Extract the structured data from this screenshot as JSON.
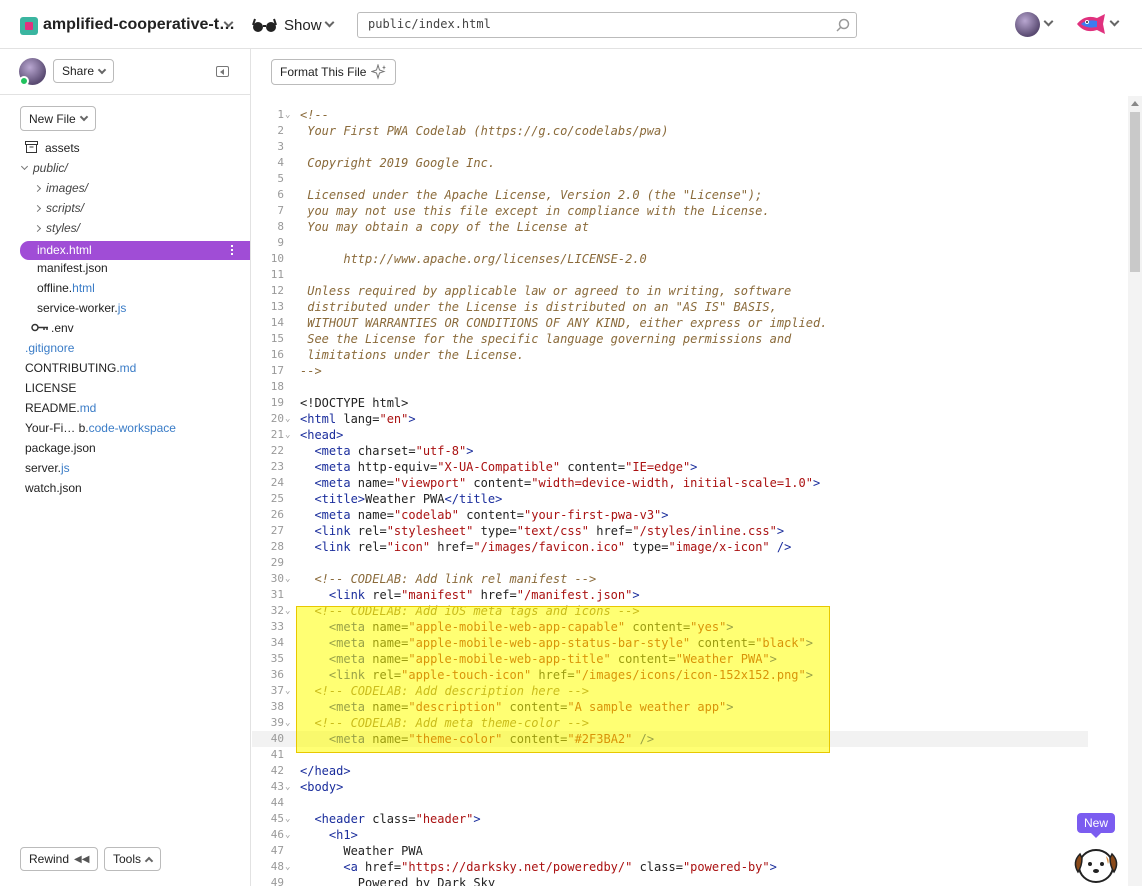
{
  "topbar": {
    "project_name": "amplified-cooperative-t…",
    "show_label": "Show",
    "file_path": "public/index.html"
  },
  "sidebar": {
    "share_label": "Share",
    "new_file_label": "New File",
    "rewind_label": "Rewind",
    "tools_label": "Tools",
    "files": [
      {
        "name": "assets",
        "ext": "",
        "kind": "assets"
      },
      {
        "name": "public/",
        "ext": "",
        "kind": "folder-open"
      },
      {
        "name": "images/",
        "ext": "",
        "kind": "folder"
      },
      {
        "name": "scripts/",
        "ext": "",
        "kind": "folder"
      },
      {
        "name": "styles/",
        "ext": "",
        "kind": "folder"
      },
      {
        "name": "index.html",
        "ext": "",
        "kind": "selected"
      },
      {
        "name": "manifest.json",
        "ext": "",
        "kind": "file"
      },
      {
        "name": "offline.",
        "ext": "html",
        "kind": "file"
      },
      {
        "name": "service-worker.",
        "ext": "js",
        "kind": "file"
      },
      {
        "name": ".env",
        "ext": "",
        "kind": "env"
      },
      {
        "name": "",
        "ext": ".gitignore",
        "kind": "file"
      },
      {
        "name": "CONTRIBUTING.",
        "ext": "md",
        "kind": "file"
      },
      {
        "name": "LICENSE",
        "ext": "",
        "kind": "file"
      },
      {
        "name": "README.",
        "ext": "md",
        "kind": "file"
      },
      {
        "name": "Your-Fi… b.",
        "ext": "code-workspace",
        "kind": "file"
      },
      {
        "name": "package.json",
        "ext": "",
        "kind": "file"
      },
      {
        "name": "server.",
        "ext": "js",
        "kind": "file"
      },
      {
        "name": "watch.json",
        "ext": "",
        "kind": "file"
      }
    ]
  },
  "editor": {
    "format_label": "Format This File",
    "new_badge": "New",
    "lines": [
      {
        "n": "1",
        "f": true,
        "t": [
          [
            "cm",
            "<!--"
          ]
        ]
      },
      {
        "n": "2",
        "t": [
          [
            "cm",
            " Your First PWA Codelab (https://g.co/codelabs/pwa)"
          ]
        ]
      },
      {
        "n": "3",
        "t": []
      },
      {
        "n": "4",
        "t": [
          [
            "cm",
            " Copyright 2019 Google Inc."
          ]
        ]
      },
      {
        "n": "5",
        "t": []
      },
      {
        "n": "6",
        "t": [
          [
            "cm",
            " Licensed under the Apache License, Version 2.0 (the \"License\");"
          ]
        ]
      },
      {
        "n": "7",
        "t": [
          [
            "cm",
            " you may not use this file except in compliance with the License."
          ]
        ]
      },
      {
        "n": "8",
        "t": [
          [
            "cm",
            " You may obtain a copy of the License at"
          ]
        ]
      },
      {
        "n": "9",
        "t": []
      },
      {
        "n": "10",
        "t": [
          [
            "cm",
            "      http://www.apache.org/licenses/LICENSE-2.0"
          ]
        ]
      },
      {
        "n": "11",
        "t": []
      },
      {
        "n": "12",
        "t": [
          [
            "cm",
            " Unless required by applicable law or agreed to in writing, software"
          ]
        ]
      },
      {
        "n": "13",
        "t": [
          [
            "cm",
            " distributed under the License is distributed on an \"AS IS\" BASIS,"
          ]
        ]
      },
      {
        "n": "14",
        "t": [
          [
            "cm",
            " WITHOUT WARRANTIES OR CONDITIONS OF ANY KIND, either express or implied."
          ]
        ]
      },
      {
        "n": "15",
        "t": [
          [
            "cm",
            " See the License for the specific language governing permissions and"
          ]
        ]
      },
      {
        "n": "16",
        "t": [
          [
            "cm",
            " limitations under the License."
          ]
        ]
      },
      {
        "n": "17",
        "t": [
          [
            "cm",
            "-->"
          ]
        ]
      },
      {
        "n": "18",
        "t": []
      },
      {
        "n": "19",
        "t": [
          [
            "at",
            "<!DOCTYPE html>"
          ]
        ]
      },
      {
        "n": "20",
        "f": true,
        "t": [
          [
            "tg",
            "<html"
          ],
          [
            "at",
            " lang="
          ],
          [
            "st",
            "\"en\""
          ],
          [
            "tg",
            ">"
          ]
        ]
      },
      {
        "n": "21",
        "f": true,
        "t": [
          [
            "tg",
            "<head>"
          ]
        ]
      },
      {
        "n": "22",
        "t": [
          [
            "at",
            "  "
          ],
          [
            "tg",
            "<meta"
          ],
          [
            "at",
            " charset="
          ],
          [
            "st",
            "\"utf-8\""
          ],
          [
            "tg",
            ">"
          ]
        ]
      },
      {
        "n": "23",
        "t": [
          [
            "at",
            "  "
          ],
          [
            "tg",
            "<meta"
          ],
          [
            "at",
            " http-equiv="
          ],
          [
            "st",
            "\"X-UA-Compatible\""
          ],
          [
            "at",
            " content="
          ],
          [
            "st",
            "\"IE=edge\""
          ],
          [
            "tg",
            ">"
          ]
        ]
      },
      {
        "n": "24",
        "t": [
          [
            "at",
            "  "
          ],
          [
            "tg",
            "<meta"
          ],
          [
            "at",
            " name="
          ],
          [
            "st",
            "\"viewport\""
          ],
          [
            "at",
            " content="
          ],
          [
            "st",
            "\"width=device-width, initial-scale=1.0\""
          ],
          [
            "tg",
            ">"
          ]
        ]
      },
      {
        "n": "25",
        "t": [
          [
            "at",
            "  "
          ],
          [
            "tg",
            "<title>"
          ],
          [
            "at",
            "Weather PWA"
          ],
          [
            "tg",
            "</title>"
          ]
        ]
      },
      {
        "n": "26",
        "t": [
          [
            "at",
            "  "
          ],
          [
            "tg",
            "<meta"
          ],
          [
            "at",
            " name="
          ],
          [
            "st",
            "\"codelab\""
          ],
          [
            "at",
            " content="
          ],
          [
            "st",
            "\"your-first-pwa-v3\""
          ],
          [
            "tg",
            ">"
          ]
        ]
      },
      {
        "n": "27",
        "t": [
          [
            "at",
            "  "
          ],
          [
            "tg",
            "<link"
          ],
          [
            "at",
            " rel="
          ],
          [
            "st",
            "\"stylesheet\""
          ],
          [
            "at",
            " type="
          ],
          [
            "st",
            "\"text/css\""
          ],
          [
            "at",
            " href="
          ],
          [
            "st",
            "\"/styles/inline.css\""
          ],
          [
            "tg",
            ">"
          ]
        ]
      },
      {
        "n": "28",
        "t": [
          [
            "at",
            "  "
          ],
          [
            "tg",
            "<link"
          ],
          [
            "at",
            " rel="
          ],
          [
            "st",
            "\"icon\""
          ],
          [
            "at",
            " href="
          ],
          [
            "st",
            "\"/images/favicon.ico\""
          ],
          [
            "at",
            " type="
          ],
          [
            "st",
            "\"image/x-icon\""
          ],
          [
            "tg",
            " />"
          ]
        ]
      },
      {
        "n": "29",
        "t": []
      },
      {
        "n": "30",
        "f": true,
        "t": [
          [
            "at",
            "  "
          ],
          [
            "cm",
            "<!-- CODELAB: Add link rel manifest -->"
          ]
        ]
      },
      {
        "n": "31",
        "t": [
          [
            "at",
            "    "
          ],
          [
            "tg",
            "<link"
          ],
          [
            "at",
            " rel="
          ],
          [
            "st",
            "\"manifest\""
          ],
          [
            "at",
            " href="
          ],
          [
            "st",
            "\"/manifest.json\""
          ],
          [
            "tg",
            ">"
          ]
        ]
      },
      {
        "n": "32",
        "f": true,
        "t": [
          [
            "at",
            "  "
          ],
          [
            "cm",
            "<!-- CODELAB: Add iOS meta tags and icons -->"
          ]
        ]
      },
      {
        "n": "33",
        "t": [
          [
            "at",
            "    "
          ],
          [
            "tg",
            "<meta"
          ],
          [
            "at",
            " name="
          ],
          [
            "st",
            "\"apple-mobile-web-app-capable\""
          ],
          [
            "at",
            " content="
          ],
          [
            "st",
            "\"yes\""
          ],
          [
            "tg",
            ">"
          ]
        ]
      },
      {
        "n": "34",
        "t": [
          [
            "at",
            "    "
          ],
          [
            "tg",
            "<meta"
          ],
          [
            "at",
            " name="
          ],
          [
            "st",
            "\"apple-mobile-web-app-status-bar-style\""
          ],
          [
            "at",
            " content="
          ],
          [
            "st",
            "\"black\""
          ],
          [
            "tg",
            ">"
          ]
        ]
      },
      {
        "n": "35",
        "t": [
          [
            "at",
            "    "
          ],
          [
            "tg",
            "<meta"
          ],
          [
            "at",
            " name="
          ],
          [
            "st",
            "\"apple-mobile-web-app-title\""
          ],
          [
            "at",
            " content="
          ],
          [
            "st",
            "\"Weather PWA\""
          ],
          [
            "tg",
            ">"
          ]
        ]
      },
      {
        "n": "36",
        "t": [
          [
            "at",
            "    "
          ],
          [
            "tg",
            "<link"
          ],
          [
            "at",
            " rel="
          ],
          [
            "st",
            "\"apple-touch-icon\""
          ],
          [
            "at",
            " href="
          ],
          [
            "st",
            "\"/images/icons/icon-152x152.png\""
          ],
          [
            "tg",
            ">"
          ]
        ]
      },
      {
        "n": "37",
        "f": true,
        "t": [
          [
            "at",
            "  "
          ],
          [
            "cm",
            "<!-- CODELAB: Add description here -->"
          ]
        ]
      },
      {
        "n": "38",
        "t": [
          [
            "at",
            "    "
          ],
          [
            "tg",
            "<meta"
          ],
          [
            "at",
            " name="
          ],
          [
            "st",
            "\"description\""
          ],
          [
            "at",
            " content="
          ],
          [
            "st",
            "\"A sample weather app\""
          ],
          [
            "tg",
            ">"
          ]
        ]
      },
      {
        "n": "39",
        "f": true,
        "t": [
          [
            "at",
            "  "
          ],
          [
            "cm",
            "<!-- CODELAB: Add meta theme-color -->"
          ]
        ]
      },
      {
        "n": "40",
        "t": [
          [
            "at",
            "    "
          ],
          [
            "tg",
            "<meta"
          ],
          [
            "at",
            " name="
          ],
          [
            "st",
            "\"theme-color\""
          ],
          [
            "at",
            " content="
          ],
          [
            "st",
            "\"#2F3BA2\""
          ],
          [
            "tg",
            " />"
          ]
        ]
      },
      {
        "n": "41",
        "t": []
      },
      {
        "n": "42",
        "t": [
          [
            "tg",
            "</head>"
          ]
        ]
      },
      {
        "n": "43",
        "f": true,
        "t": [
          [
            "tg",
            "<body>"
          ]
        ]
      },
      {
        "n": "44",
        "t": []
      },
      {
        "n": "45",
        "f": true,
        "t": [
          [
            "at",
            "  "
          ],
          [
            "tg",
            "<header"
          ],
          [
            "at",
            " class="
          ],
          [
            "st",
            "\"header\""
          ],
          [
            "tg",
            ">"
          ]
        ]
      },
      {
        "n": "46",
        "f": true,
        "t": [
          [
            "at",
            "    "
          ],
          [
            "tg",
            "<h1>"
          ]
        ]
      },
      {
        "n": "47",
        "t": [
          [
            "at",
            "      Weather PWA"
          ]
        ]
      },
      {
        "n": "48",
        "f": true,
        "t": [
          [
            "at",
            "      "
          ],
          [
            "tg",
            "<a"
          ],
          [
            "at",
            " href="
          ],
          [
            "st",
            "\"https://darksky.net/poweredby/\""
          ],
          [
            "at",
            " class="
          ],
          [
            "st",
            "\"powered-by\""
          ],
          [
            "tg",
            ">"
          ]
        ]
      },
      {
        "n": "49",
        "t": [
          [
            "at",
            "        Powered by Dark Sky"
          ]
        ]
      }
    ]
  },
  "colors": {
    "accent": "#a04dd6",
    "highlight": "#ffff00",
    "new_badge": "#7b5cf0"
  }
}
